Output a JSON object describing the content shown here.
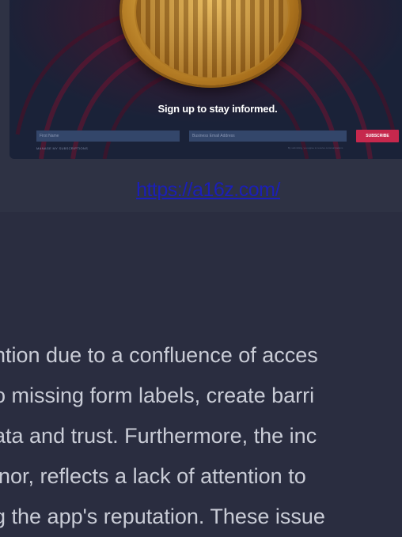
{
  "newsletter": {
    "heading": "Sign up to stay informed.",
    "first_name_placeholder": "First Name",
    "email_placeholder": "Business Email Address",
    "subscribe_label": "SUBSCRIBE",
    "left_note": "MANAGE MY SUBSCRIPTIONS",
    "right_note": "By submitting, you agree to receive communications",
    "accent_color": "#c6284d"
  },
  "link": {
    "text": "https://a16z.com/"
  },
  "body": {
    "lines": [
      "ntion due to a confluence of acces",
      "o missing form labels, create barri",
      "ata and trust. Furthermore, the inc",
      "inor, reflects a lack of attention to",
      "g the app's reputation. These issue"
    ]
  }
}
